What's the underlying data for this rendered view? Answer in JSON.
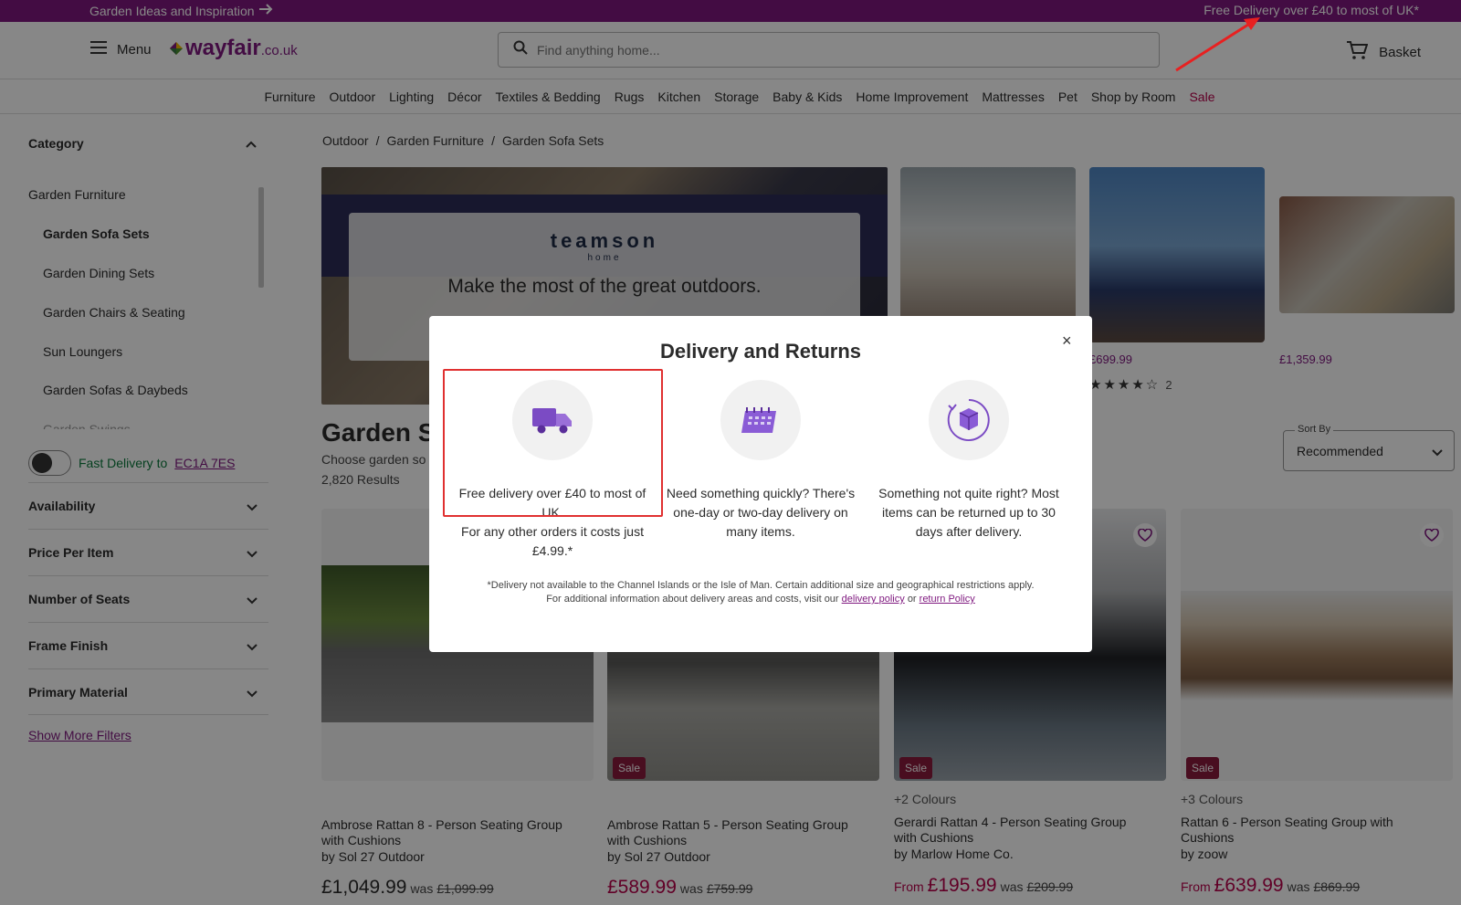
{
  "promo": {
    "left_text": "Garden Ideas and Inspiration",
    "right_text": "Free Delivery over £40 to most of UK*"
  },
  "header": {
    "menu_label": "Menu",
    "logo_main": "wayfair",
    "logo_tld": ".co.uk",
    "search_placeholder": "Find anything home...",
    "basket_label": "Basket"
  },
  "nav": {
    "items": [
      "Furniture",
      "Outdoor",
      "Lighting",
      "Décor",
      "Textiles & Bedding",
      "Rugs",
      "Kitchen",
      "Storage",
      "Baby & Kids",
      "Home Improvement",
      "Mattresses",
      "Pet",
      "Shop by Room"
    ],
    "sale": "Sale",
    "sale_color": "#b8004a"
  },
  "sidebar": {
    "category_heading": "Category",
    "categories": [
      "Garden Furniture",
      "Garden Sofa Sets",
      "Garden Dining Sets",
      "Garden Chairs & Seating",
      "Sun Loungers",
      "Garden Sofas & Daybeds",
      "Garden Swings"
    ],
    "fast_delivery": "Fast Delivery to",
    "postcode": "EC1A 7ES",
    "filters": [
      "Availability",
      "Price Per Item",
      "Number of Seats",
      "Frame Finish",
      "Primary Material"
    ],
    "show_more": "Show More Filters"
  },
  "breadcrumb": [
    "Outdoor",
    "Garden Furniture",
    "Garden Sofa Sets"
  ],
  "hero": {
    "brand": "teamson",
    "brand_sub": "home",
    "tagline": "Make the most of the great outdoors."
  },
  "thumbs": [
    {
      "price": ""
    },
    {
      "price": "£699.99",
      "rating": 4.5,
      "reviews": "2"
    },
    {
      "price": "£1,359.99"
    }
  ],
  "listing": {
    "title": "Garden S",
    "subtitle": "Choose garden so",
    "results": "2,820 Results",
    "sort_label": "Sort By",
    "sort_value": "Recommended"
  },
  "products": [
    {
      "title_l1": "Ambrose Rattan 8 - Person Seating Group",
      "title_l2": "with Cushions",
      "by": "by Sol 27 Outdoor",
      "from": "",
      "price": "£1,049.99",
      "was_label": "was",
      "was": "£1,099.99",
      "colours": "",
      "sale": ""
    },
    {
      "title_l1": "Ambrose Rattan 5 - Person Seating Group",
      "title_l2": "with Cushions",
      "by": "by Sol 27 Outdoor",
      "from": "",
      "price": "£589.99",
      "was_label": "was",
      "was": "£759.99",
      "colours": "",
      "sale": "Sale"
    },
    {
      "title_l1": "Gerardi Rattan 4 - Person Seating Group",
      "title_l2": "with Cushions",
      "by": "by Marlow Home Co.",
      "from": "From",
      "price": "£195.99",
      "was_label": "was",
      "was": "£209.99",
      "colours": "+2 Colours",
      "sale": "Sale"
    },
    {
      "title_l1": "Rattan 6 - Person Seating Group with",
      "title_l2": "Cushions",
      "by": "by zoow",
      "from": "From",
      "price": "£639.99",
      "was_label": "was",
      "was": "£869.99",
      "colours": "+3 Colours",
      "sale": "Sale"
    }
  ],
  "modal": {
    "title": "Delivery and Returns",
    "close": "×",
    "columns": [
      {
        "icon": "delivery-truck-icon",
        "line1": "Free delivery over £40 to most of UK.",
        "line2": "For any other orders it costs just £4.99.*"
      },
      {
        "icon": "calendar-icon",
        "line1": "Need something quickly? There's one-day or two-day delivery on many items.",
        "line2": ""
      },
      {
        "icon": "returns-box-icon",
        "line1": "Something not quite right? Most items can be returned up to 30 days after delivery.",
        "line2": ""
      }
    ],
    "footnote_1": "*Delivery not available to the Channel Islands or the Isle of Man. Certain additional size and geographical restrictions apply.",
    "footnote_2": "For additional information about delivery areas and costs, visit our",
    "delivery_link": "delivery policy",
    "or": "or",
    "return_link": "return Policy"
  },
  "colors": {
    "brand_purple": "#7f187f",
    "sale_red": "#b8004a",
    "highlight_red": "#e03030"
  }
}
